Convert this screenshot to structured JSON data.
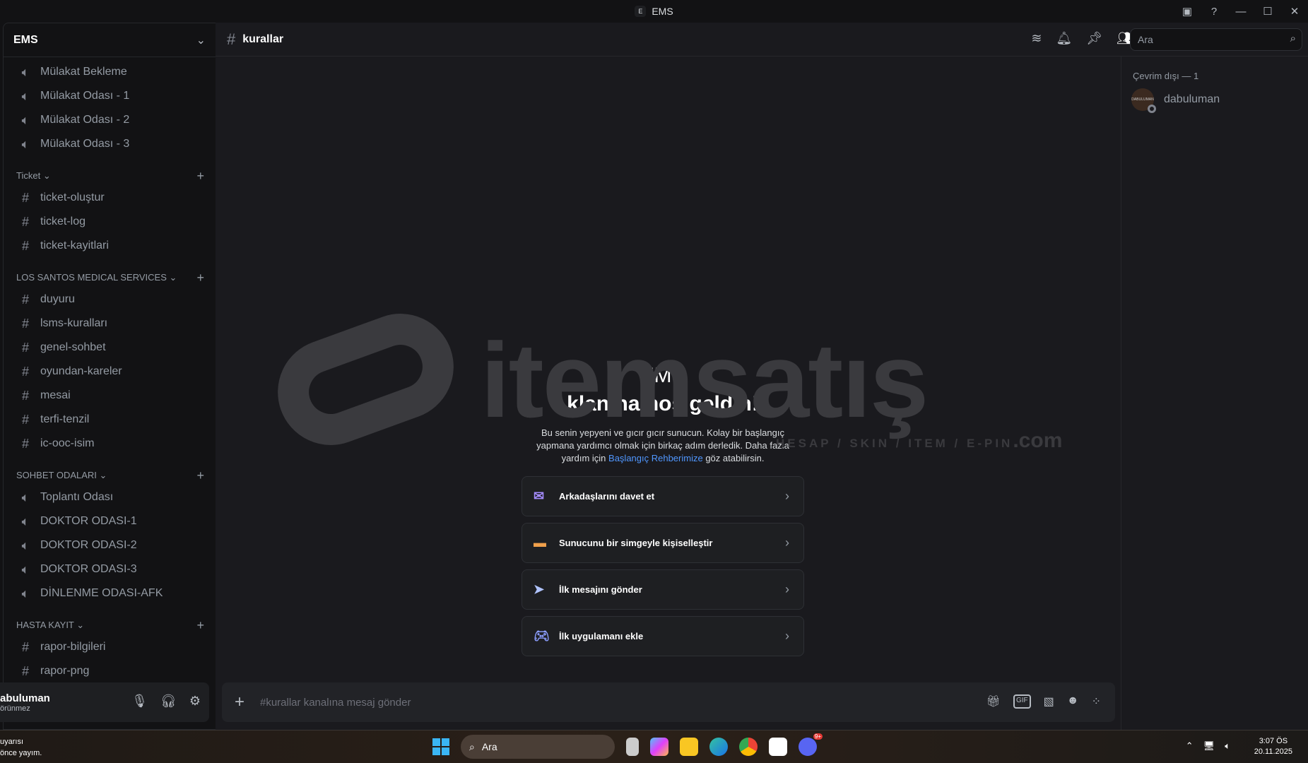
{
  "window": {
    "title": "EMS",
    "logo_letter": "E"
  },
  "server": {
    "name": "EMS"
  },
  "channels_top": [
    {
      "type": "voice",
      "name": "Mülakat Bekleme"
    },
    {
      "type": "voice",
      "name": "Mülakat Odası - 1"
    },
    {
      "type": "voice",
      "name": "Mülakat Odası - 2"
    },
    {
      "type": "voice",
      "name": "Mülakat Odası - 3"
    }
  ],
  "categories": [
    {
      "name": "Ticket",
      "channels": [
        {
          "type": "text",
          "name": "ticket-oluştur"
        },
        {
          "type": "text",
          "name": "ticket-log"
        },
        {
          "type": "text",
          "name": "ticket-kayitlari"
        }
      ]
    },
    {
      "name": "LOS SANTOS MEDICAL SERVICES",
      "channels": [
        {
          "type": "text",
          "name": "duyuru"
        },
        {
          "type": "text",
          "name": "lsms-kuralları"
        },
        {
          "type": "text",
          "name": "genel-sohbet"
        },
        {
          "type": "text",
          "name": "oyundan-kareler"
        },
        {
          "type": "text",
          "name": "mesai"
        },
        {
          "type": "text",
          "name": "terfi-tenzil"
        },
        {
          "type": "text",
          "name": "ic-ooc-isim"
        }
      ]
    },
    {
      "name": "SOHBET ODALARI",
      "channels": [
        {
          "type": "voice",
          "name": "Toplantı Odası"
        },
        {
          "type": "voice",
          "name": "DOKTOR ODASI-1"
        },
        {
          "type": "voice",
          "name": "DOKTOR ODASI-2"
        },
        {
          "type": "voice",
          "name": "DOKTOR ODASI-3"
        },
        {
          "type": "voice",
          "name": "DİNLENME ODASI-AFK"
        }
      ]
    },
    {
      "name": "HASTA KAYIT",
      "channels": [
        {
          "type": "text",
          "name": "rapor-bilgileri"
        },
        {
          "type": "text",
          "name": "rapor-png"
        }
      ]
    }
  ],
  "user": {
    "name": "abuluman",
    "status": "örünmez"
  },
  "channel": {
    "name": "kurallar"
  },
  "search": {
    "placeholder": "Ara"
  },
  "members": {
    "header": "Çevrim dışı — 1",
    "list": [
      {
        "name": "dabuluman",
        "avatar_text": "DABULUMAN"
      }
    ]
  },
  "watermark": {
    "text": "itemsatış",
    "sub": "HESAP / SKIN / ITEM / E-PIN",
    "com": ".com"
  },
  "welcome": {
    "title": "EMS",
    "subtitle": "klanına hoş geldin!",
    "text1": "Bu senin yepyeni ve gıcır gıcır sunucun. Kolay bir başlangıç yapmana yardımcı olmak için birkaç adım derledik. Daha fazla yardım için ",
    "link": "Başlangıç Rehberimize",
    "text2": " göz atabilirsin."
  },
  "actions": [
    {
      "label": "Arkadaşlarını davet et",
      "icon": "invite-icon"
    },
    {
      "label": "Sunucunu bir simgeyle kişiselleştir",
      "icon": "server-icon"
    },
    {
      "label": "İlk mesajını gönder",
      "icon": "paper-plane-icon"
    },
    {
      "label": "İlk uygulamanı ekle",
      "icon": "gamepad-icon"
    }
  ],
  "composer": {
    "placeholder": "#kurallar kanalına mesaj gönder"
  },
  "taskbar": {
    "notif_line1": "uyarısı",
    "notif_line2": "önce yayım.",
    "search": "Ara",
    "time": "3:07 ÖS",
    "date": "20.11.2025",
    "badge": "9+"
  }
}
